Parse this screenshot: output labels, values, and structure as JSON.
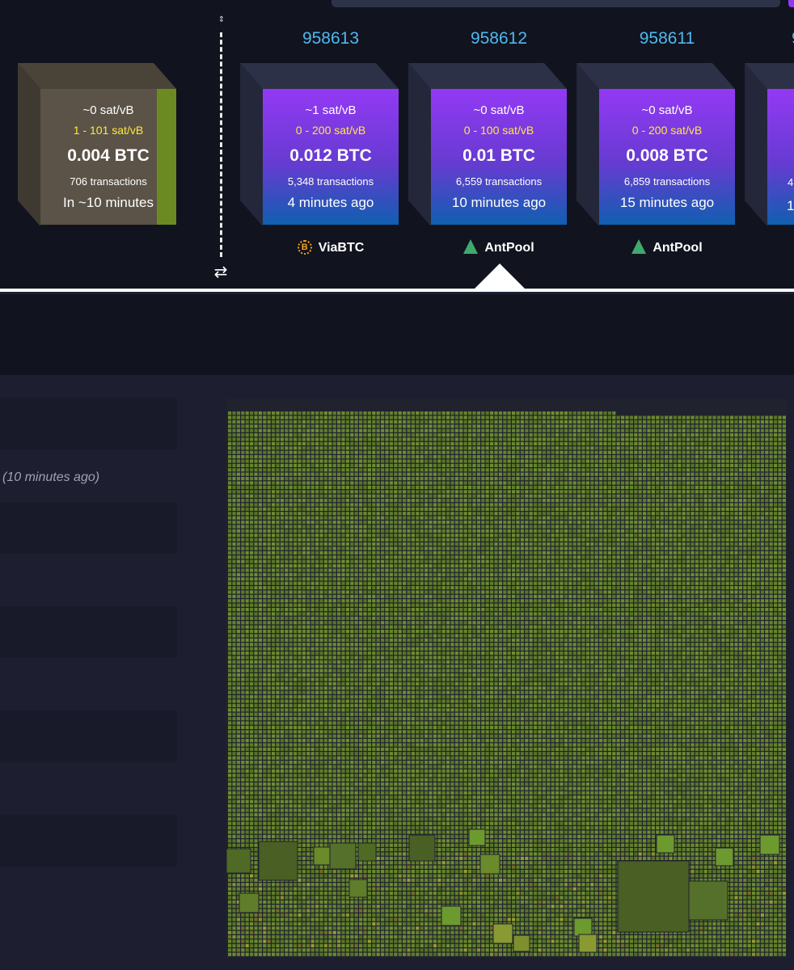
{
  "pending_block": {
    "median_fee": "~0 sat/vB",
    "fee_range": "1 - 101 sat/vB",
    "total": "0.004 BTC",
    "tx_count": "706 transactions",
    "eta": "In ~10 minutes"
  },
  "mined_blocks": [
    {
      "height": "958613",
      "median_fee": "~1 sat/vB",
      "fee_range": "0 - 200 sat/vB",
      "total": "0.012 BTC",
      "tx_count": "5,348 transactions",
      "time": "4 minutes ago",
      "pool": "ViaBTC",
      "pool_icon": "viabtc-logo-icon"
    },
    {
      "height": "958612",
      "median_fee": "~0 sat/vB",
      "fee_range": "0 - 100 sat/vB",
      "total": "0.01 BTC",
      "tx_count": "6,559 transactions",
      "time": "10 minutes ago",
      "pool": "AntPool",
      "pool_icon": "antpool-logo-icon",
      "selected": true
    },
    {
      "height": "958611",
      "median_fee": "~0 sat/vB",
      "fee_range": "0 - 200 sat/vB",
      "total": "0.008 BTC",
      "tx_count": "6,859 transactions",
      "time": "15 minutes ago",
      "pool": "AntPool",
      "pool_icon": "antpool-logo-icon"
    }
  ],
  "partial_block": {
    "height_fragment": "9",
    "tx_fragment": "4",
    "time_fragment": "1"
  },
  "details": {
    "timestamp_relative": "(10 minutes ago)"
  },
  "controls": {
    "swap_icon": "swap-arrows-icon",
    "divider_icon": "chevron-updown-icon"
  },
  "colors": {
    "block_gradient_top": "#9339f4",
    "block_gradient_bottom": "#105fb0",
    "height_link": "#4fb9ee",
    "fee_range": "#ffea42",
    "tx_low_fee": "#5f7d2a",
    "tx_large": "#4a5f24"
  }
}
